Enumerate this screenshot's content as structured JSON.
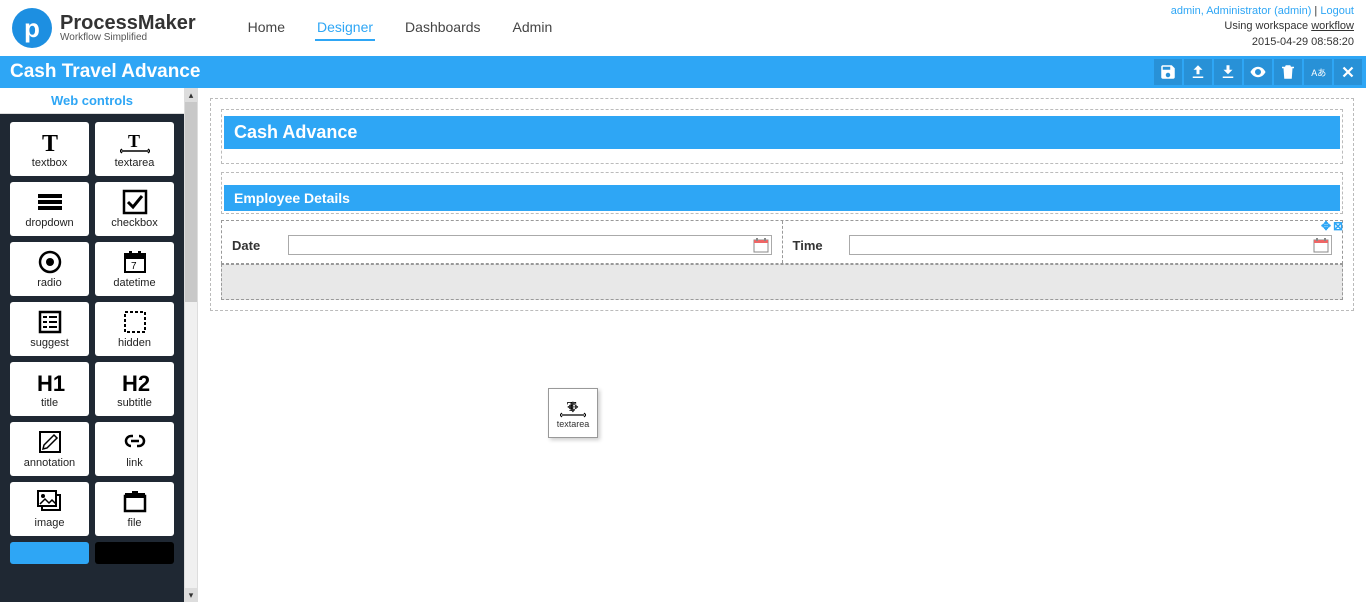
{
  "brand": {
    "name": "ProcessMaker",
    "tagline": "Workflow Simplified"
  },
  "nav": {
    "home": "Home",
    "designer": "Designer",
    "dashboards": "Dashboards",
    "admin": "Admin"
  },
  "header_right": {
    "user_line": "admin, Administrator (admin)",
    "sep": " | ",
    "logout": "Logout",
    "workspace_prefix": "Using workspace ",
    "workspace": "workflow",
    "timestamp": "2015-04-29 08:58:20"
  },
  "titlebar": {
    "title": "Cash Travel Advance"
  },
  "sidebar": {
    "header": "Web controls",
    "items": [
      {
        "label": "textbox"
      },
      {
        "label": "textarea"
      },
      {
        "label": "dropdown"
      },
      {
        "label": "checkbox"
      },
      {
        "label": "radio"
      },
      {
        "label": "datetime"
      },
      {
        "label": "suggest"
      },
      {
        "label": "hidden"
      },
      {
        "label": "title"
      },
      {
        "label": "subtitle"
      },
      {
        "label": "annotation"
      },
      {
        "label": "link"
      },
      {
        "label": "image"
      },
      {
        "label": "file"
      }
    ]
  },
  "form": {
    "title": "Cash Advance",
    "section": "Employee Details",
    "fields": {
      "date": "Date",
      "time": "Time"
    }
  },
  "drag": {
    "label": "textarea"
  }
}
